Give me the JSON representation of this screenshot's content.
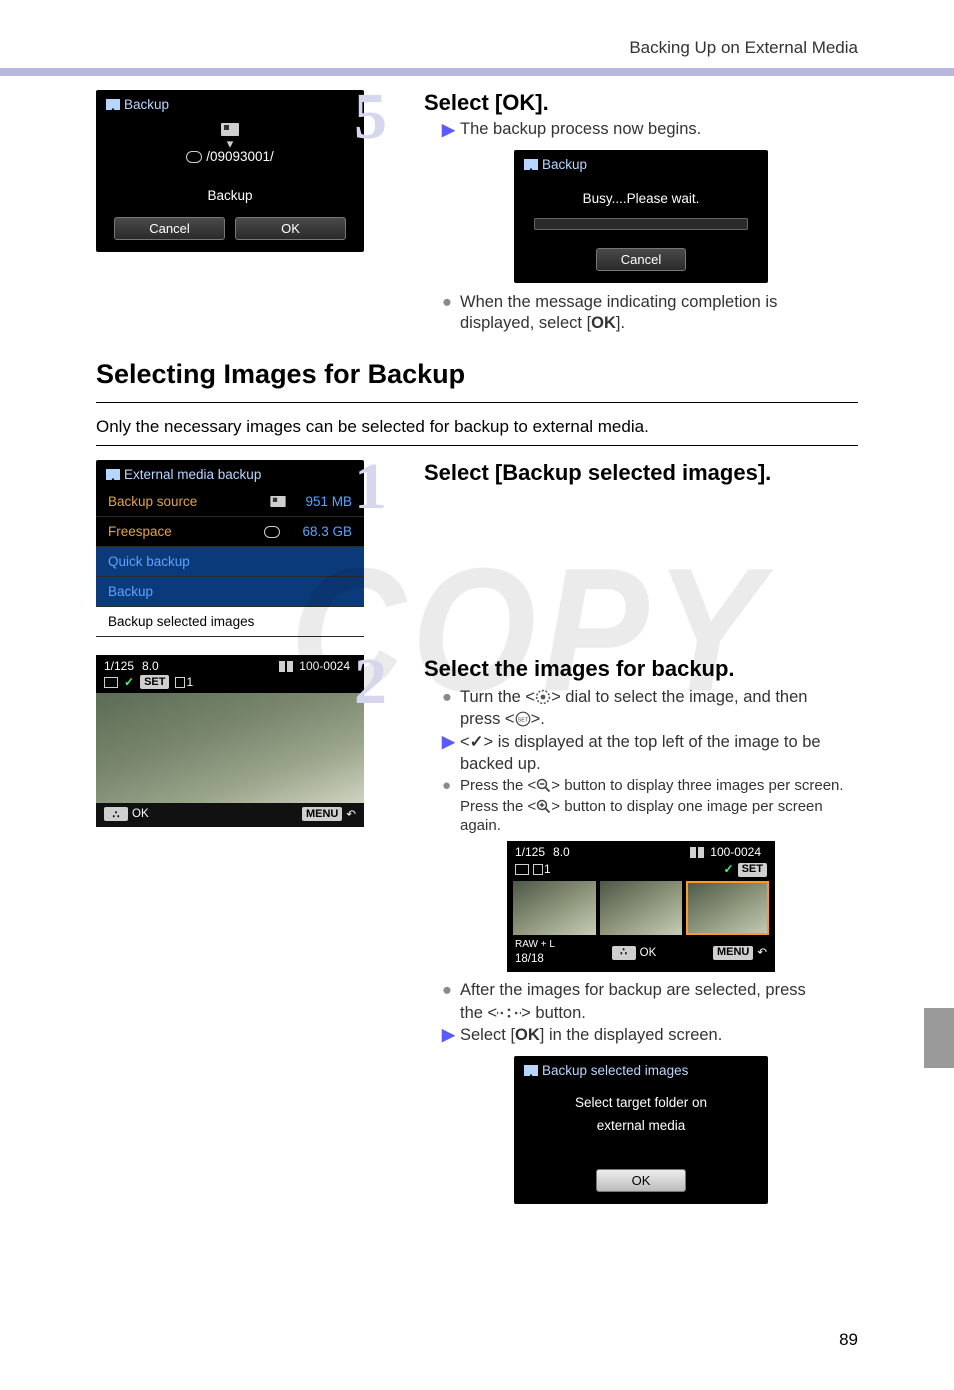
{
  "header": {
    "breadcrumb": "Backing Up on External Media"
  },
  "page_number": "89",
  "watermark": "COPY",
  "step5": {
    "title": "Select [OK].",
    "line1": "The backup process now begins.",
    "lcd_confirm": {
      "title": "Backup",
      "folder": "/09093001/",
      "action": "Backup",
      "cancel": "Cancel",
      "ok": "OK"
    },
    "lcd_progress": {
      "title": "Backup",
      "status": "Busy....Please wait.",
      "cancel": "Cancel"
    },
    "completion_a": "When the message indicating completion is",
    "completion_b": "displayed, select [",
    "completion_ok": "OK",
    "completion_c": "]."
  },
  "section": {
    "heading": "Selecting Images for Backup",
    "intro": "Only the necessary images can be selected for backup to external media."
  },
  "step1": {
    "title": "Select [Backup selected images].",
    "lcd_menu": {
      "title": "External media backup",
      "source_label": "Backup source",
      "source_value": "951 MB",
      "free_label": "Freespace",
      "free_value": "68.3 GB",
      "item_quick": "Quick backup",
      "item_backup": "Backup",
      "item_selected": "Backup selected images"
    }
  },
  "step2": {
    "title": "Select the images for backup.",
    "b1a": "Turn the <",
    "b1b": "> dial to select the image, and then",
    "b1c": "press <",
    "b1d": ">.",
    "a1a": "<",
    "a1b": "> is displayed at the top left of the image to be",
    "a1c": "backed up.",
    "b2a": "Press the <",
    "b2b": "> button to display three images per screen.",
    "b2c": "Press the <",
    "b2d": "> button to display one image per screen again.",
    "lcd_review": {
      "shutter": "1/125",
      "aperture": "8.0",
      "folder_file": "100-0024",
      "card_slot": "1",
      "set_label": "SET",
      "ok_label": "OK",
      "menu_label": "MENU"
    },
    "lcd_thumbs": {
      "shutter": "1/125",
      "aperture": "8.0",
      "folder_file": "100-0024",
      "card_slot": "1",
      "quality": "RAW + L",
      "count": "18/18",
      "ok_label": "OK",
      "menu_label": "MENU",
      "set_label": "SET"
    },
    "after_a": "After the images for backup are selected, press",
    "after_b": "the <",
    "after_c": "> button.",
    "select_ok_a": "Select [",
    "select_ok_b": "OK",
    "select_ok_c": "] in the displayed screen.",
    "lcd_sel": {
      "title": "Backup selected images",
      "msg1": "Select target folder on",
      "msg2": "external media",
      "ok": "OK"
    }
  }
}
